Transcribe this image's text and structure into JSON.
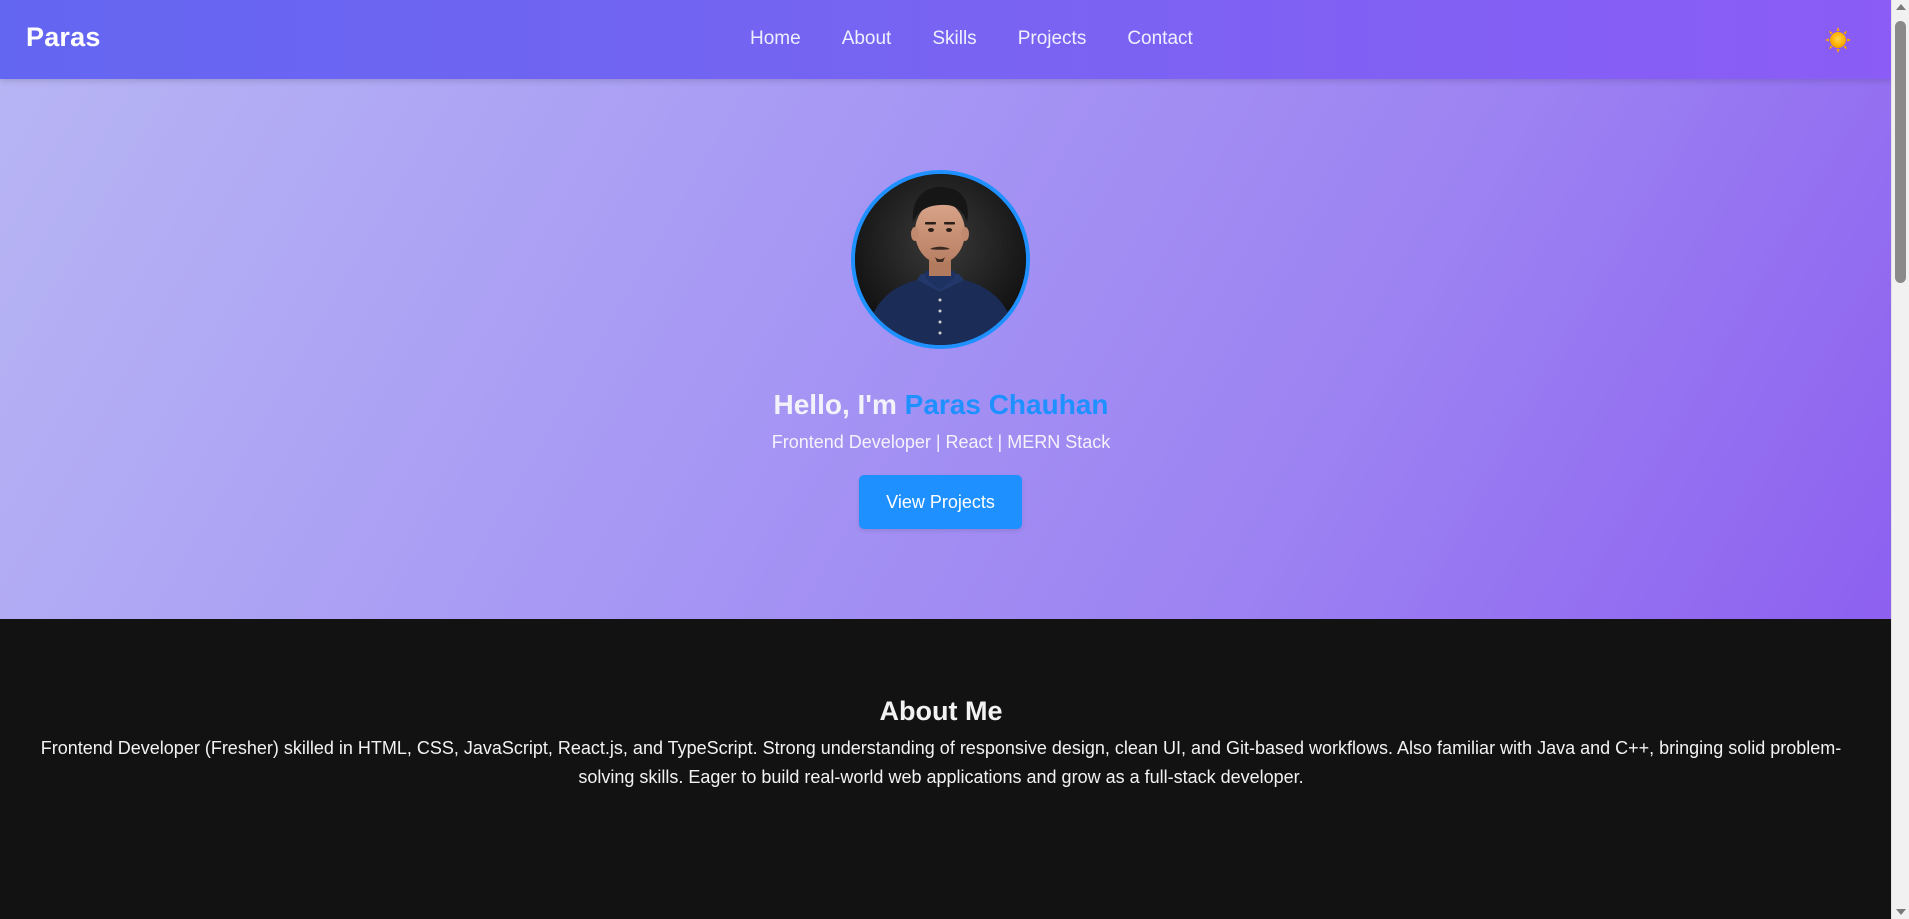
{
  "navbar": {
    "brand": "Paras",
    "links": [
      "Home",
      "About",
      "Skills",
      "Projects",
      "Contact"
    ],
    "theme_toggle_icon": "sun-icon"
  },
  "hero": {
    "greeting": "Hello, I'm ",
    "name": "Paras Chauhan",
    "subtitle": "Frontend Developer | React | MERN Stack",
    "cta_label": "View Projects",
    "avatar_alt": "profile-photo"
  },
  "about": {
    "title": "About Me",
    "text": "Frontend Developer (Fresher) skilled in HTML, CSS, JavaScript, React.js, and TypeScript. Strong understanding of responsive design, clean UI, and Git-based workflows. Also familiar with Java and C++, bringing solid problem-solving skills. Eager to build real-world web applications and grow as a full-stack developer."
  },
  "colors": {
    "accent": "#1e90ff",
    "nav_start": "#6366f1",
    "nav_end": "#8b5cf6",
    "dark_bg": "#121212"
  }
}
